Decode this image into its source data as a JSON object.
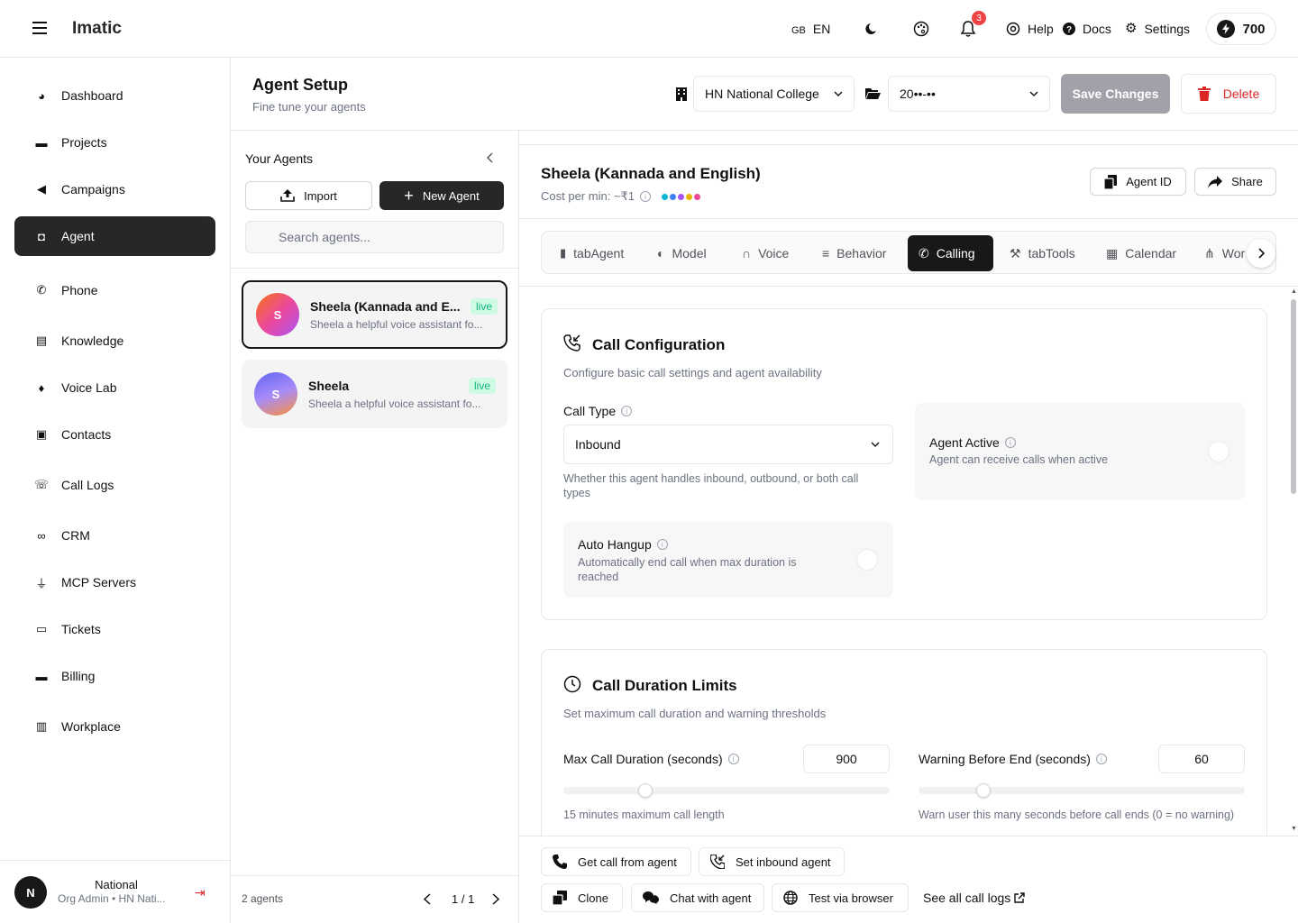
{
  "app": {
    "name": "Imatic"
  },
  "topbar": {
    "lang_code": "GB",
    "lang": "EN",
    "notif_count": "3",
    "help": "Help",
    "docs": "Docs",
    "settings": "Settings",
    "credits": "700"
  },
  "sidebar": {
    "items": [
      {
        "label": "Dashboard",
        "icon": "dashboard-icon"
      },
      {
        "label": "Projects",
        "icon": "folder-icon"
      },
      {
        "label": "Campaigns",
        "icon": "megaphone-icon"
      },
      {
        "label": "Agent",
        "icon": "bot-icon",
        "active": true
      },
      {
        "label": "Phone",
        "icon": "phone-icon"
      },
      {
        "label": "Knowledge",
        "icon": "book-icon"
      },
      {
        "label": "Voice Lab",
        "icon": "mic-icon"
      },
      {
        "label": "Contacts",
        "icon": "contacts-icon"
      },
      {
        "label": "Call Logs",
        "icon": "call-log-icon"
      },
      {
        "label": "CRM",
        "icon": "link-icon"
      },
      {
        "label": "MCP Servers",
        "icon": "plug-icon"
      },
      {
        "label": "Tickets",
        "icon": "ticket-icon"
      },
      {
        "label": "Billing",
        "icon": "card-icon"
      },
      {
        "label": "Workplace",
        "icon": "building-icon"
      }
    ],
    "user": {
      "initial": "N",
      "name": "National",
      "role": "Org Admin • HN Nati..."
    }
  },
  "header": {
    "title": "Agent Setup",
    "subtitle": "Fine tune your agents",
    "org_select": "HN National College",
    "project_select": "20••-••",
    "save": "Save Changes",
    "delete": "Delete"
  },
  "agents": {
    "title": "Your Agents",
    "import": "Import",
    "new": "New Agent",
    "search_placeholder": "Search agents...",
    "list": [
      {
        "initial": "S",
        "name": "Sheela (Kannada and E...",
        "desc": "Sheela a helpful voice assistant fo...",
        "status": "live"
      },
      {
        "initial": "S",
        "name": "Sheela",
        "desc": "Sheela a helpful voice assistant fo...",
        "status": "live"
      }
    ],
    "count": "2 agents",
    "page": "1 / 1"
  },
  "detail": {
    "name": "Sheela (Kannada and English)",
    "cost": "Cost per min: ~₹1",
    "agent_id": "Agent ID",
    "share": "Share",
    "dot_colors": [
      "#06b6d4",
      "#3b82f6",
      "#a855f7",
      "#eab308",
      "#ec4899"
    ],
    "tabs": [
      "tabAgent",
      "Model",
      "Voice",
      "Behavior",
      "Calling",
      "tabTools",
      "Calendar",
      "Wor"
    ],
    "active_tab": "Calling"
  },
  "call_config": {
    "title": "Call Configuration",
    "desc": "Configure basic call settings and agent availability",
    "call_type_label": "Call Type",
    "call_type_value": "Inbound",
    "call_type_help": "Whether this agent handles inbound, outbound, or both call types",
    "agent_active_title": "Agent Active",
    "agent_active_desc": "Agent can receive calls when active",
    "auto_hangup_title": "Auto Hangup",
    "auto_hangup_desc": "Automatically end call when max duration is reached"
  },
  "duration": {
    "title": "Call Duration Limits",
    "desc": "Set maximum call duration and warning thresholds",
    "max_label": "Max Call Duration (seconds)",
    "max_value": "900",
    "max_help": "15 minutes maximum call length",
    "max_slider_fraction": 0.25,
    "warn_label": "Warning Before End (seconds)",
    "warn_value": "60",
    "warn_help": "Warn user this many seconds before call ends (0 = no warning)",
    "warn_slider_fraction": 0.2
  },
  "footer": {
    "get_call": "Get call from agent",
    "set_inbound": "Set inbound agent",
    "clone": "Clone",
    "chat": "Chat with agent",
    "test": "Test via browser",
    "see_logs": "See all call logs"
  }
}
